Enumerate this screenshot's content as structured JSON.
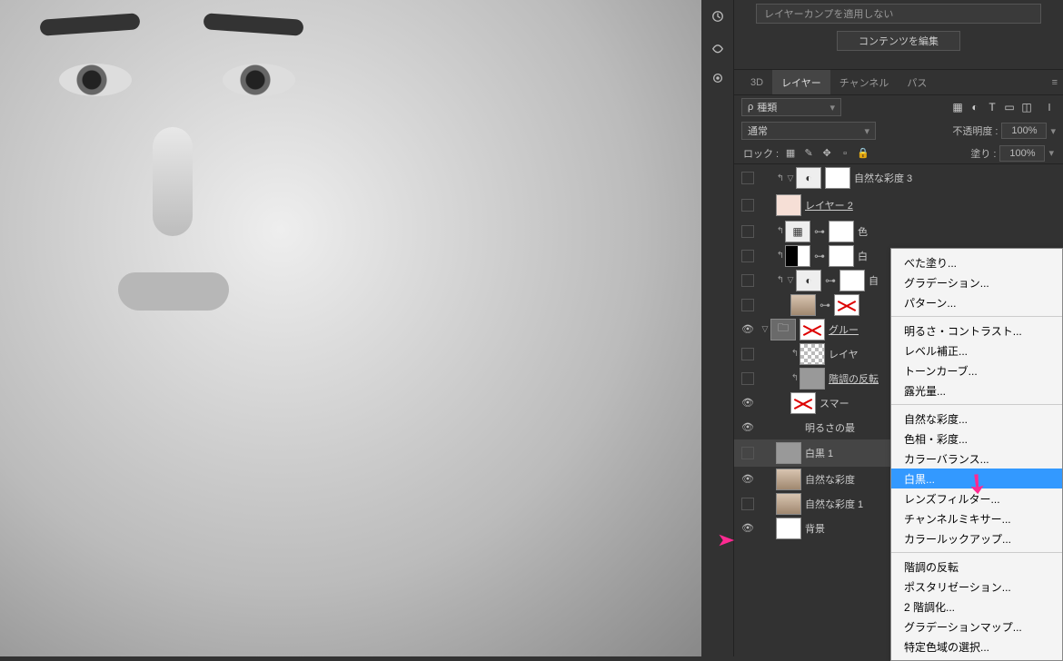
{
  "properties": {
    "layer_comp_select": "レイヤーカンプを適用しない",
    "edit_contents_btn": "コンテンツを編集"
  },
  "panel_tabs": {
    "t0": "3D",
    "t1": "レイヤー",
    "t2": "チャンネル",
    "t3": "パス"
  },
  "filter": {
    "search_prefix": "ρ",
    "kind_select": "種類"
  },
  "blend": {
    "mode_select": "通常",
    "opacity_label": "不透明度 :",
    "opacity_value": "100%",
    "lock_label": "ロック :",
    "fill_label": "塗り :",
    "fill_value": "100%"
  },
  "layers": {
    "l0": "自然な彩度 3",
    "l1": "レイヤー 2",
    "l2": "色",
    "l3": "白",
    "l4": "自",
    "l5": "グルー",
    "l6": "レイヤ",
    "l7": "階調の反転",
    "l8": "スマー",
    "l9": "明るさの最",
    "l10": "白黒 1",
    "l11": "自然な彩度",
    "l12": "自然な彩度 1",
    "l13": "背景"
  },
  "menu": {
    "solid": "べた塗り...",
    "gradient": "グラデーション...",
    "pattern": "パターン...",
    "brightness": "明るさ・コントラスト...",
    "levels": "レベル補正...",
    "curves": "トーンカーブ...",
    "exposure": "露光量...",
    "vibrance": "自然な彩度...",
    "hue": "色相・彩度...",
    "colorbalance": "カラーバランス...",
    "bw": "白黒...",
    "photo_filter": "レンズフィルター...",
    "mixer": "チャンネルミキサー...",
    "lookup": "カラールックアップ...",
    "invert": "階調の反転",
    "posterize": "ポスタリゼーション...",
    "threshold": "2 階調化...",
    "gradmap": "グラデーションマップ...",
    "selective": "特定色域の選択..."
  }
}
